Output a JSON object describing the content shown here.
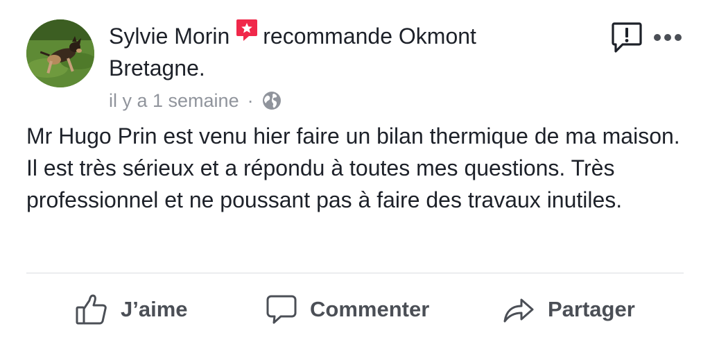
{
  "post": {
    "author": "Sylvie Morin",
    "action_text": "recommande Okmont",
    "page_name_continued": "Bretagne.",
    "timestamp": "il y a 1 semaine",
    "separator": "·",
    "audience_icon": "globe-icon",
    "body": "Mr Hugo Prin est venu hier faire un bilan thermique de ma maison. Il est très sérieux et a répondu à toutes mes questions. Très professionnel et ne poussant pas à faire des travaux inutiles."
  },
  "icons": {
    "recommend": "recommendation-star-icon",
    "report": "report-icon",
    "more": "more-options-icon"
  },
  "actions": {
    "like_label": "J’aime",
    "comment_label": "Commenter",
    "share_label": "Partager"
  },
  "colors": {
    "text": "#1d2129",
    "secondary_text": "#90949c",
    "action_text": "#4b4f56",
    "recommend_badge": "#f0284a",
    "divider": "#dadde1"
  }
}
